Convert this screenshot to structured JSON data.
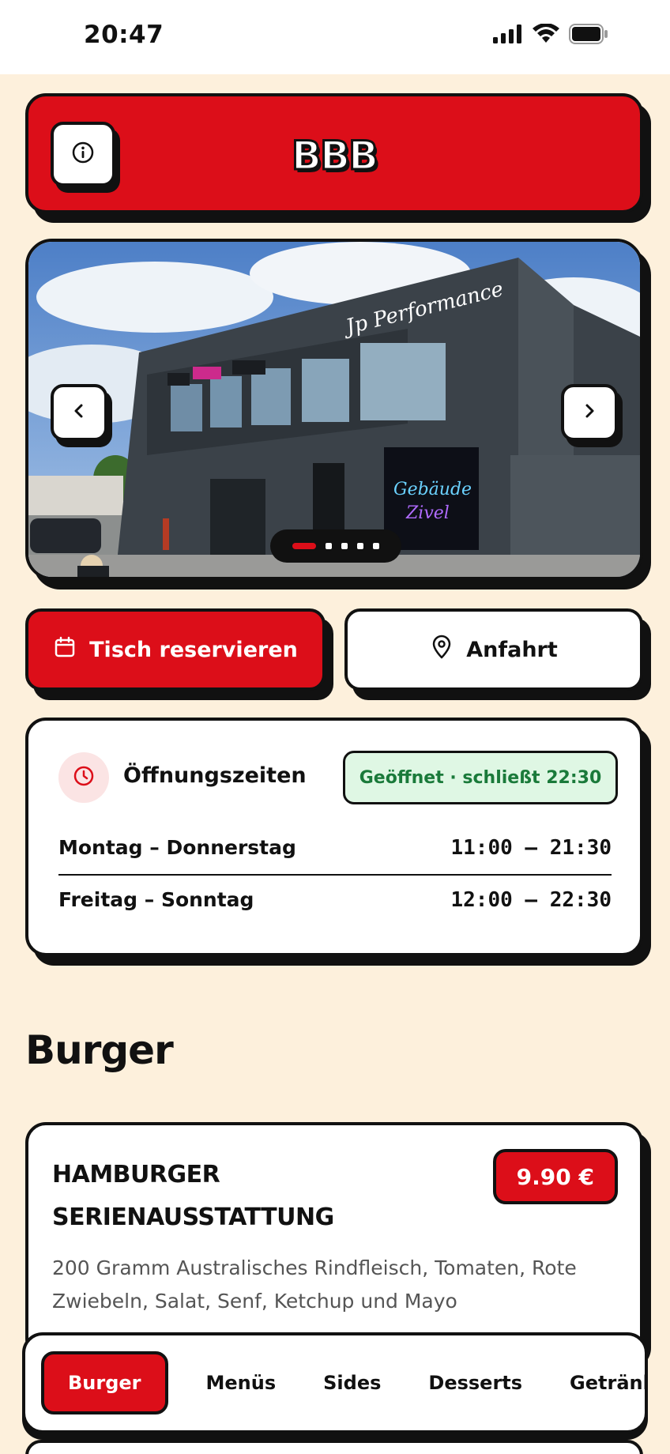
{
  "status_bar": {
    "time": "20:47",
    "icons": [
      "signal-icon",
      "wifi-icon",
      "battery-icon"
    ]
  },
  "header": {
    "logo_text": "BBB",
    "info_icon": "info-icon",
    "brand_color": "#dc0e19"
  },
  "hero": {
    "storefront_sign": "Jp Performance",
    "mural_text": "Gebäude Zivel",
    "slide_count": 5,
    "active_slide": 1
  },
  "actions": {
    "reserve_label": "Tisch reservieren",
    "reserve_icon": "calendar-icon",
    "route_label": "Anfahrt",
    "route_icon": "map-pin-icon"
  },
  "hours": {
    "title": "Öffnungszeiten",
    "status": "Geöffnet · schließt 22:30",
    "rows": [
      {
        "days": "Montag – Donnerstag",
        "time": "11:00 – 21:30"
      },
      {
        "days": "Freitag – Sonntag",
        "time": "12:00 – 22:30"
      }
    ]
  },
  "menu": {
    "section_title": "Burger",
    "items": [
      {
        "name": "Hamburger Serienausstattung",
        "price": "9.90 €",
        "description": "200 Gramm Australisches Rindfleisch, Tomaten, Rote Zwiebeln, Salat, Senf, Ketchup und Mayo"
      }
    ]
  },
  "categories": {
    "active": "Burger",
    "tabs": [
      "Burger",
      "Menüs",
      "Sides",
      "Desserts",
      "Getränke"
    ]
  },
  "colors": {
    "accent": "#dc0e19",
    "background": "#fdf0dc",
    "open_green": "#1a7a3a"
  }
}
